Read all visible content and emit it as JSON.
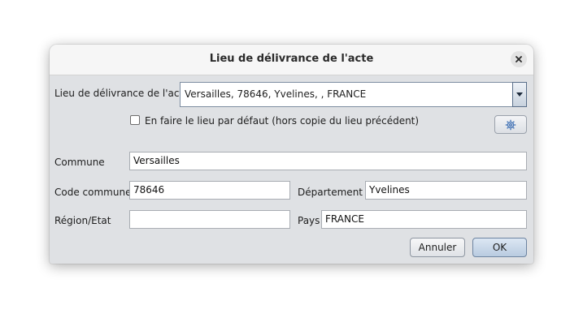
{
  "dialog": {
    "title": "Lieu de délivrance de l'acte",
    "close_icon": "close-icon"
  },
  "place_selector": {
    "label": "Lieu de délivrance de l'acte",
    "value": "Versailles, 78646, Yvelines, , FRANCE",
    "arrow_icon": "chevron-down-icon"
  },
  "default_checkbox": {
    "label": "En faire le lieu par défaut (hors copie du lieu précédent)",
    "checked": false
  },
  "settings_button": {
    "icon": "gear-icon"
  },
  "fields": {
    "commune": {
      "label": "Commune",
      "value": "Versailles"
    },
    "code_commune": {
      "label": "Code commune",
      "value": "78646"
    },
    "departement": {
      "label": "Département",
      "value": "Yvelines"
    },
    "region": {
      "label": "Région/Etat",
      "value": ""
    },
    "pays": {
      "label": "Pays",
      "value": "FRANCE"
    }
  },
  "buttons": {
    "cancel": "Annuler",
    "ok": "OK"
  }
}
